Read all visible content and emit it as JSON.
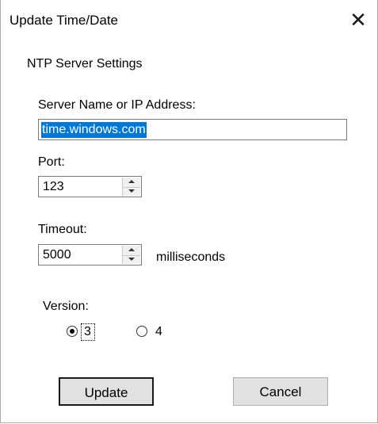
{
  "dialog": {
    "title": "Update Time/Date",
    "close_symbol": "✕"
  },
  "ntp": {
    "group_label": "NTP Server Settings",
    "server_label": "Server Name or IP Address:",
    "server_value": "time.windows.com",
    "port_label": "Port:",
    "port_value": "123",
    "timeout_label": "Timeout:",
    "timeout_value": "5000",
    "timeout_unit": "milliseconds",
    "version_label": "Version:",
    "version_options": [
      {
        "label": "3",
        "selected": true
      },
      {
        "label": "4",
        "selected": false
      }
    ]
  },
  "buttons": {
    "update_label": "Update",
    "cancel_label": "Cancel"
  }
}
